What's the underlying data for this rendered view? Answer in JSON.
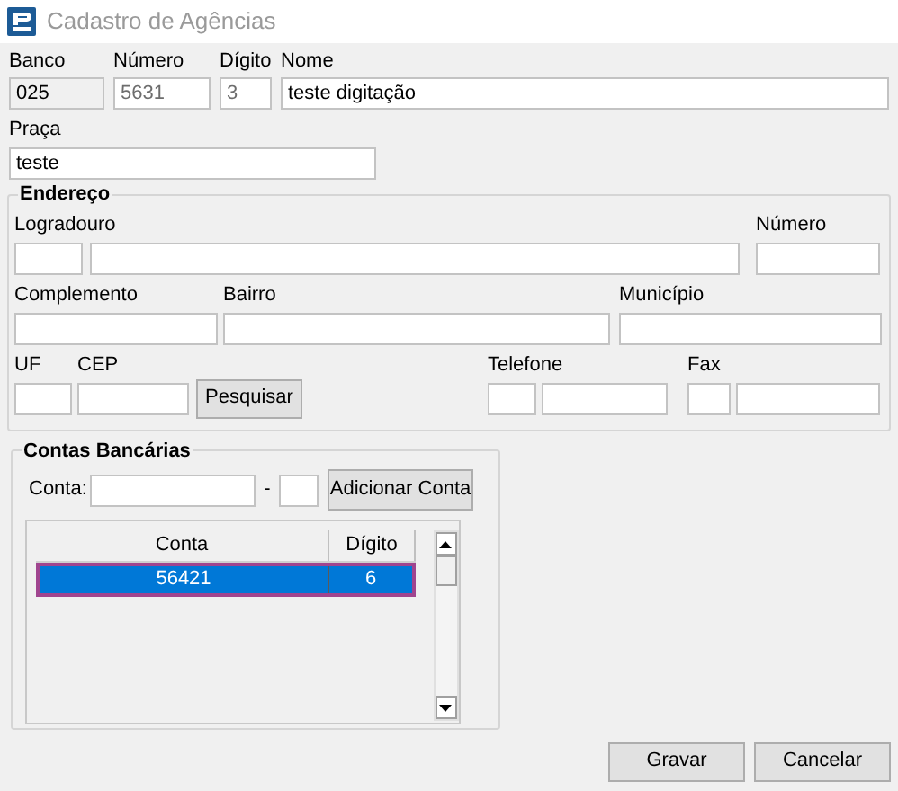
{
  "window": {
    "title": "Cadastro de Agências"
  },
  "agency_fields": [
    {
      "label": "Banco",
      "value": "025",
      "readonly": true,
      "disabled": false
    },
    {
      "label": "Número",
      "value": "5631",
      "readonly": false,
      "disabled": true
    },
    {
      "label": "Dígito",
      "value": "3",
      "readonly": false,
      "disabled": true
    },
    {
      "label": "Nome",
      "value": "teste digitação",
      "readonly": false,
      "disabled": false
    }
  ],
  "praca": {
    "label": "Praça",
    "value": "teste"
  },
  "endereco": {
    "title": "Endereço",
    "logradouro_label": "Logradouro",
    "numero_label": "Número",
    "complemento_label": "Complemento",
    "bairro_label": "Bairro",
    "municipio_label": "Município",
    "uf_label": "UF",
    "cep_label": "CEP",
    "search_button": "Pesquisar",
    "telefone_label": "Telefone",
    "fax_label": "Fax"
  },
  "contas": {
    "title": "Contas Bancárias",
    "conta_label": "Conta:",
    "separator": "-",
    "add_button": "Adicionar Conta",
    "columns": [
      "Conta",
      "Dígito"
    ],
    "rows": [
      {
        "conta": "56421",
        "digito": "6",
        "selected": true
      }
    ]
  },
  "buttons": [
    "Gravar",
    "Cancelar"
  ]
}
